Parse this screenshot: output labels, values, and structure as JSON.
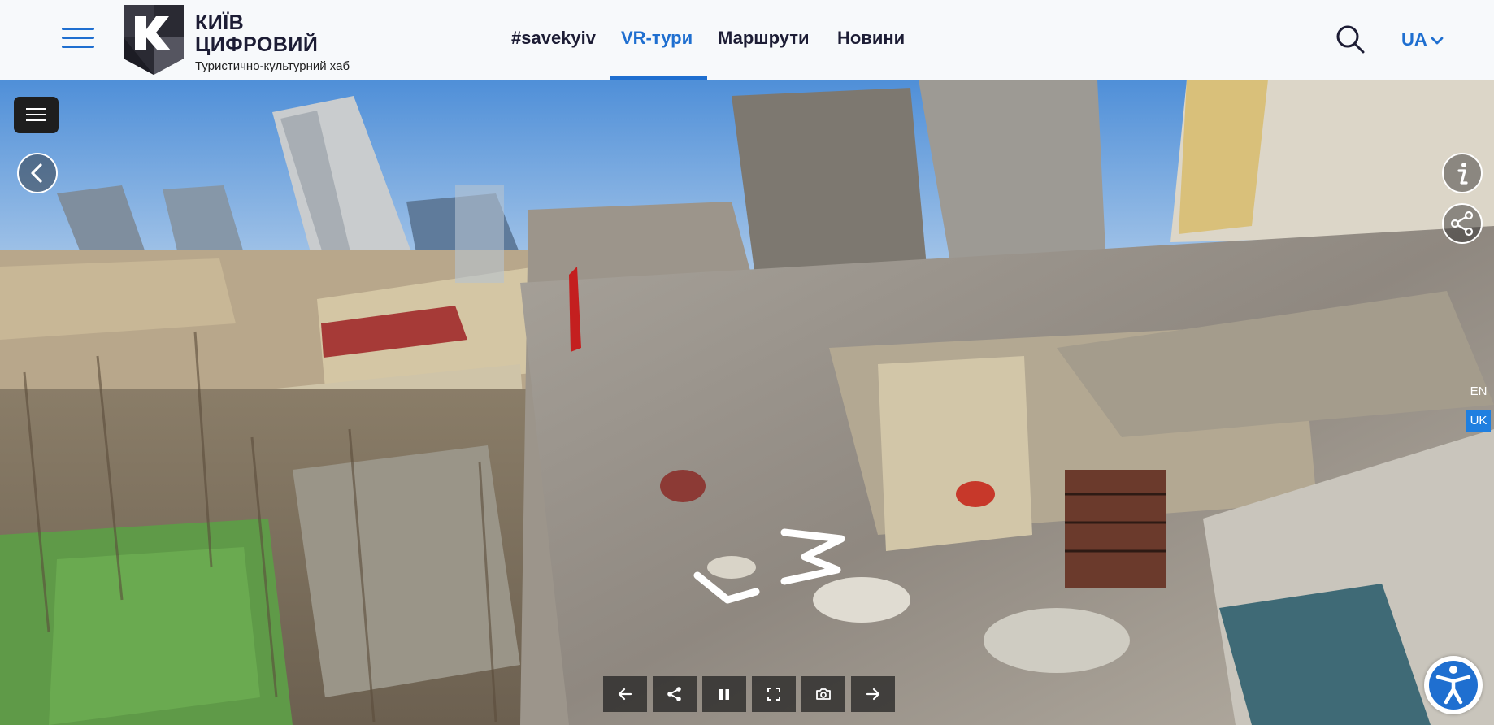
{
  "header": {
    "logo_line1": "КИЇВ",
    "logo_line2": "ЦИФРОВИЙ",
    "logo_sub": "Туристично-культурний хаб",
    "nav": [
      {
        "label": "#savekyiv",
        "active": false
      },
      {
        "label": "VR-тури",
        "active": true
      },
      {
        "label": "Маршрути",
        "active": false
      },
      {
        "label": "Новини",
        "active": false
      }
    ],
    "language": "UA",
    "accent_color": "#1f6fd0"
  },
  "viewer": {
    "side_languages": [
      "EN",
      "UK"
    ],
    "selected_language": "UK",
    "icons": {
      "menu": "menu-icon",
      "back": "chevron-left-icon",
      "info": "info-icon",
      "share": "share-icon",
      "accessibility": "accessibility-icon"
    },
    "toolbar": [
      {
        "name": "previous",
        "icon": "arrow-left-icon"
      },
      {
        "name": "share",
        "icon": "share-icon"
      },
      {
        "name": "pause",
        "icon": "pause-icon"
      },
      {
        "name": "fullscreen",
        "icon": "fullscreen-icon"
      },
      {
        "name": "screenshot",
        "icon": "camera-icon"
      },
      {
        "name": "next",
        "icon": "arrow-right-icon"
      }
    ]
  }
}
